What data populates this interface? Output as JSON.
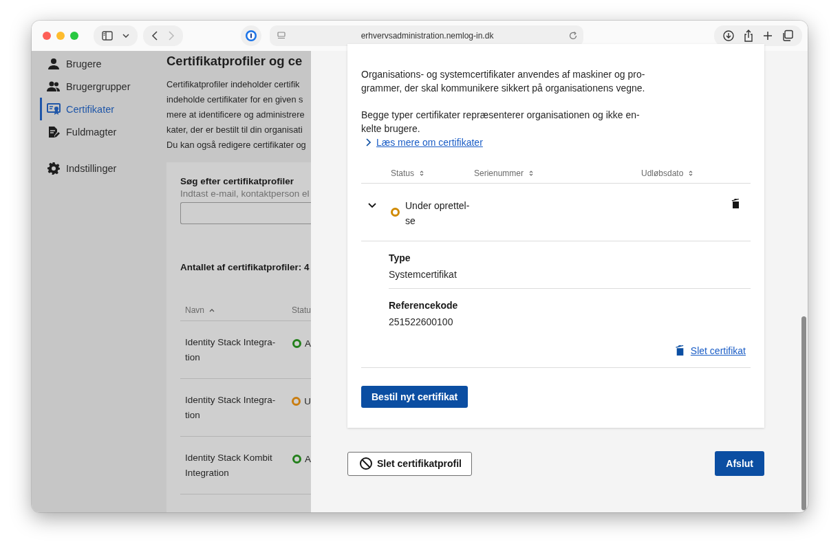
{
  "browser": {
    "url": "erhvervsadministration.nemlog-in.dk"
  },
  "sidebar": {
    "items": [
      {
        "label": "Brugere",
        "kind": "user",
        "selected": false
      },
      {
        "label": "Brugergrupper",
        "kind": "group",
        "selected": false
      },
      {
        "label": "Certifikater",
        "kind": "certificate",
        "selected": true
      },
      {
        "label": "Fuldmagter",
        "kind": "document",
        "selected": false
      },
      {
        "label": "Indstillinger",
        "kind": "gear",
        "selected": false
      }
    ]
  },
  "page": {
    "title": "Certifikatprofiler og ce",
    "intro_lines": [
      "Certifikatprofiler indeholder certifik",
      "indeholde certifikater for en given s",
      "mere at identificere og administrere",
      "kater, der er bestilt til din organisati",
      "Du kan også redigere certifikater og"
    ],
    "search": {
      "label": "Søg efter certifikatprofiler",
      "hint": "Indtast e-mail, kontaktperson el"
    },
    "count": "Antallet af certifikatprofiler: 4",
    "table": {
      "columns": [
        "Navn",
        "Statu"
      ],
      "rows": [
        {
          "name": "Identity Stack Integra-\ntion",
          "status": "A",
          "color": "#24801c"
        },
        {
          "name": "Identity Stack Integra-\ntion",
          "status": "U",
          "color": "#c97d10"
        },
        {
          "name": "Identity Stack Kombit\nIntegration",
          "status": "A",
          "color": "#24801c"
        }
      ]
    }
  },
  "modal": {
    "paragraphs": [
      "Organisations- og systemcertifikater anvendes af maskiner og pro-\ngrammer, der skal kommunikere sikkert på organisationens vegne.",
      "Begge typer certifikater repræsenterer organisationen og ikke en-\nkelte brugere."
    ],
    "link": "Læs mere om certifikater",
    "table": {
      "columns": [
        "Status",
        "Serienummer",
        "Udløbsdato"
      ],
      "rows": [
        {
          "status": "Under oprettel-\nse",
          "color": "#d08a00",
          "expanded": true,
          "details": [
            {
              "label": "Type",
              "value": "Systemcertifikat"
            },
            {
              "label": "Referencekode",
              "value": "251522600100"
            }
          ],
          "delete_link": "Slet certifikat"
        }
      ]
    },
    "order_button": "Bestil nyt certifikat",
    "delete_profile_button": "Slet certifikatprofil",
    "close_button": "Afslut"
  }
}
